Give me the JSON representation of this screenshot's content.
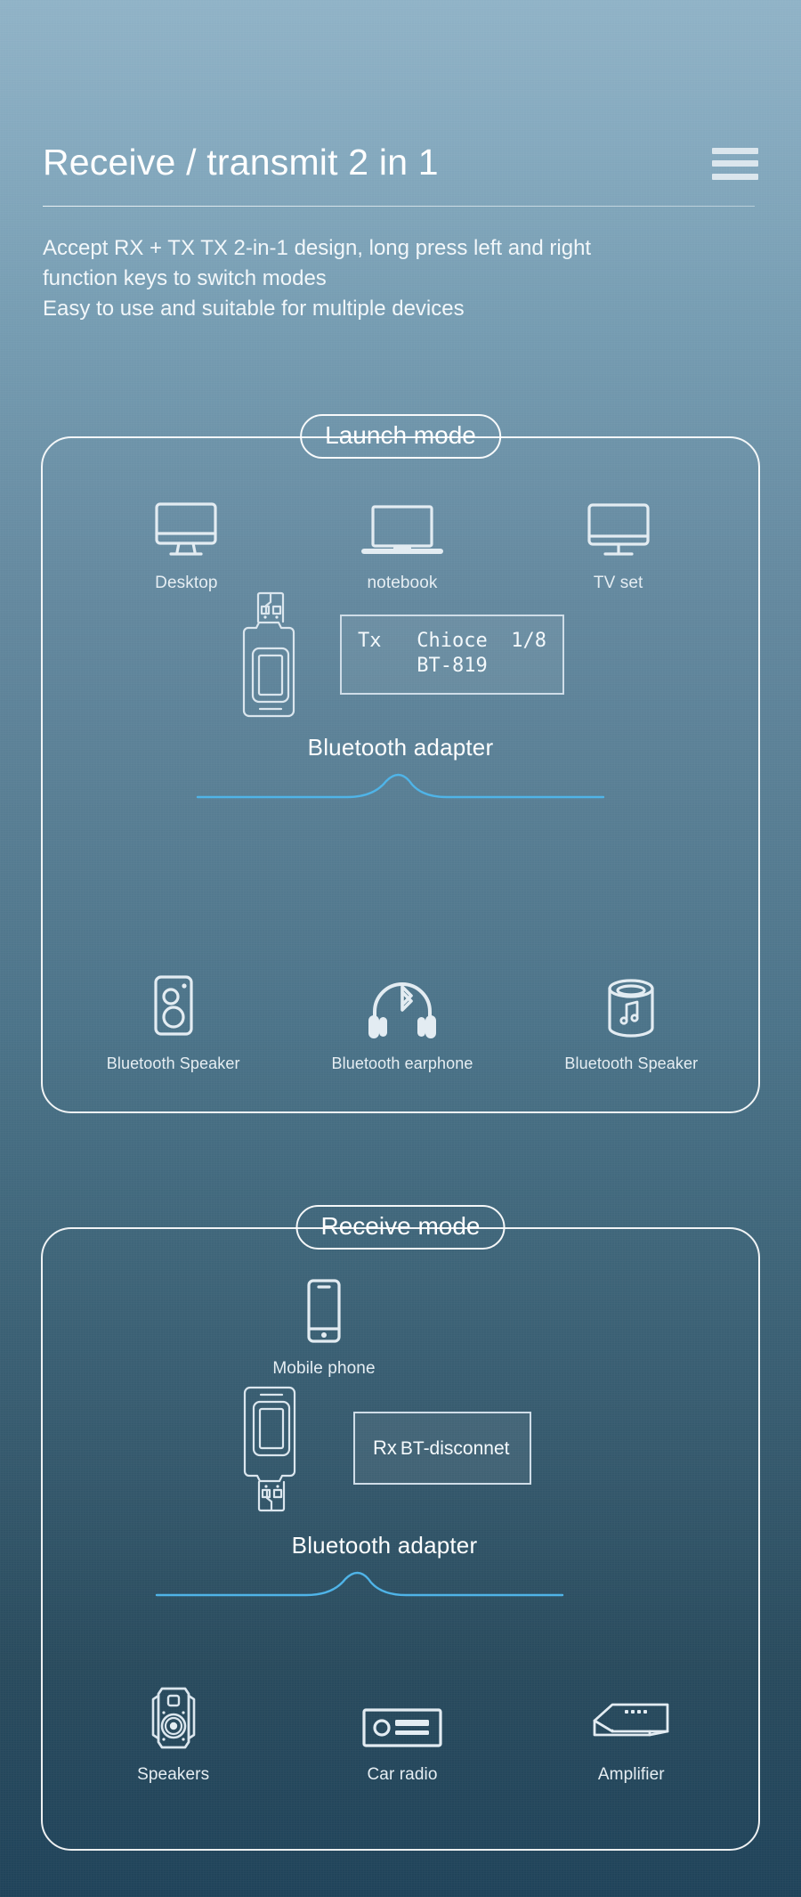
{
  "header": {
    "title": "Receive / transmit 2 in 1",
    "menu_icon": "hamburger-menu-icon",
    "subtitle_lines": [
      "Accept RX + TX TX 2-in-1 design, long press left and right",
      "function keys to switch modes",
      "Easy to use and suitable for multiple devices"
    ]
  },
  "colors": {
    "background_top": "#8fb2c6",
    "background_bottom": "#1e4259",
    "stroke": "#e3ecf2",
    "wave_accent": "#4fb4e8",
    "text": "#eef4f8"
  },
  "launch_mode": {
    "title": "Launch mode",
    "sources": [
      {
        "label": "Desktop",
        "icon": "desktop-monitor-icon"
      },
      {
        "label": "notebook",
        "icon": "laptop-icon"
      },
      {
        "label": "TV set",
        "icon": "tv-icon"
      }
    ],
    "adapter": {
      "label": "Bluetooth adapter",
      "icon": "usb-bluetooth-dongle-icon",
      "display": {
        "mode_tag": "Tx",
        "line1_mid": "Chioce",
        "line1_right": "1/8",
        "line2": "BT-819"
      }
    },
    "targets": [
      {
        "label": "Bluetooth Speaker",
        "icon": "box-speaker-icon"
      },
      {
        "label": "Bluetooth earphone",
        "icon": "headphones-bluetooth-icon"
      },
      {
        "label": "Bluetooth Speaker",
        "icon": "cylinder-speaker-music-icon"
      }
    ]
  },
  "receive_mode": {
    "title": "Receive mode",
    "sources": [
      {
        "label": "Mobile phone",
        "icon": "mobile-phone-icon"
      }
    ],
    "adapter": {
      "label": "Bluetooth adapter",
      "icon": "usb-bluetooth-dongle-flipped-icon",
      "display": {
        "mode_tag": "Rx",
        "status": "BT-disconnet"
      }
    },
    "targets": [
      {
        "label": "Speakers",
        "icon": "studio-monitor-speaker-icon"
      },
      {
        "label": "Car radio",
        "icon": "car-stereo-icon"
      },
      {
        "label": "Amplifier",
        "icon": "amplifier-box-icon"
      }
    ]
  }
}
